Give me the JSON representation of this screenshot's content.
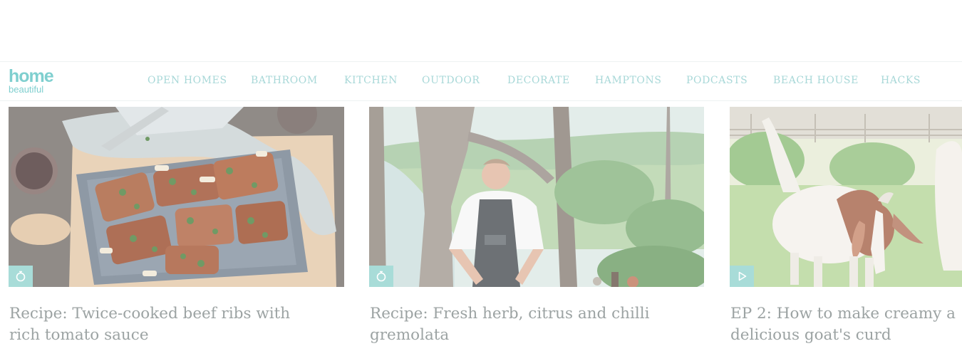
{
  "brand": {
    "logo_line1": "home",
    "logo_line2": "beautiful"
  },
  "nav": {
    "items": [
      {
        "label": "OPEN HOMES"
      },
      {
        "label": "BATHROOM"
      },
      {
        "label": "KITCHEN"
      },
      {
        "label": "OUTDOOR"
      },
      {
        "label": "DECORATE"
      },
      {
        "label": "HAMPTONS"
      },
      {
        "label": "PODCASTS"
      },
      {
        "label": "BEACH HOUSE"
      },
      {
        "label": "HACKS"
      }
    ]
  },
  "cards": [
    {
      "title_line1": "Recipe: Twice-cooked beef ribs with",
      "title_line2": "rich tomato sauce",
      "badge_icon": "recipe-icon"
    },
    {
      "title_line1": "Recipe: Fresh herb, citrus and chilli",
      "title_line2": "gremolata",
      "badge_icon": "recipe-icon"
    },
    {
      "title_line1": "EP 2: How to make creamy a",
      "title_line2": "delicious goat's curd",
      "badge_icon": "play-icon"
    }
  ],
  "colors": {
    "accent": "#7fcfcf",
    "nav_text": "#a8d8d8",
    "title_text": "#9ca3a3",
    "badge_bg": "#a8dcd8"
  }
}
